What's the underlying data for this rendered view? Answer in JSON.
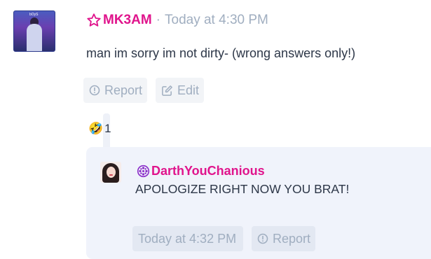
{
  "message": {
    "username": "MK3AM",
    "separator": "·",
    "timestamp": "Today at 4:30 PM",
    "text": "man im sorry im not dirty- (wrong answers only!)",
    "avatar_badge": "bOyS",
    "username_icon": "star-outline-icon",
    "username_color": "#e0148c"
  },
  "actions": {
    "report_label": "Report",
    "edit_label": "Edit"
  },
  "reaction": {
    "emoji": "🤣",
    "count": "1"
  },
  "reply": {
    "username": "DarthYouChanious",
    "username_icon": "film-reel-icon",
    "text": "APOLOGIZE RIGHT NOW YOU BRAT!",
    "timestamp": "Today at 4:32 PM",
    "report_label": "Report"
  }
}
